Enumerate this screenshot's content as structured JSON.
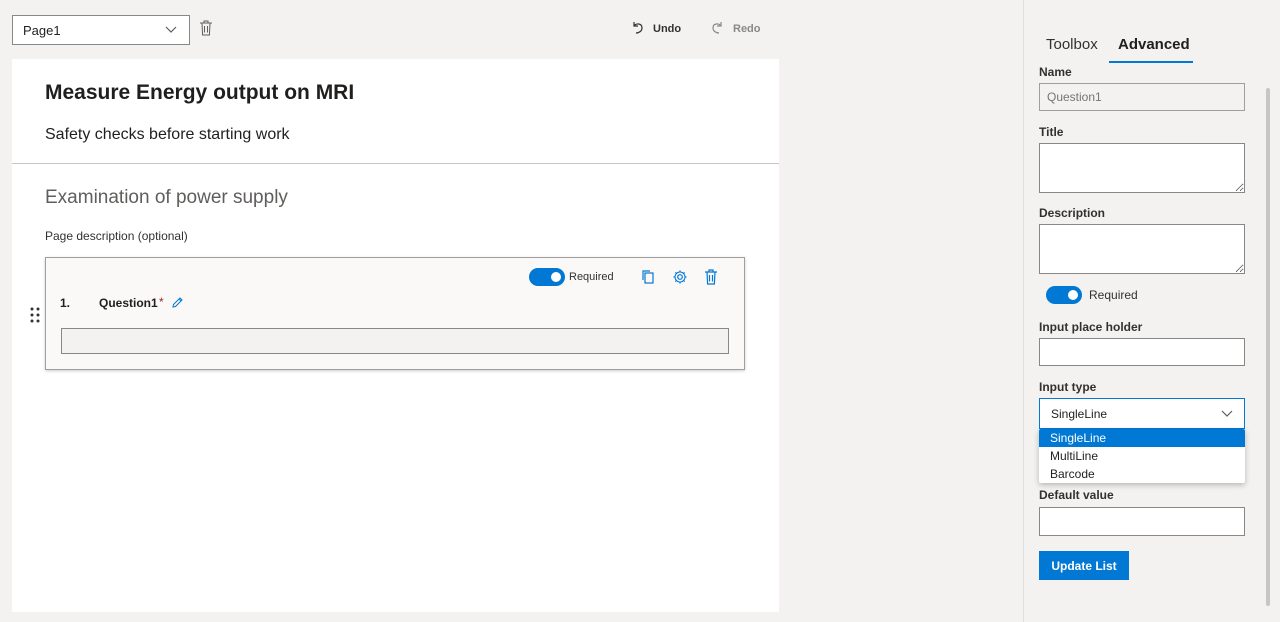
{
  "toolbar": {
    "page_selected": "Page1",
    "undo_label": "Undo",
    "redo_label": "Redo"
  },
  "form": {
    "title": "Measure Energy output on MRI",
    "description": "Safety checks before starting work",
    "page_title": "Examination of power supply",
    "page_description": "Page description (optional)"
  },
  "question": {
    "number": "1.",
    "name": "Question1",
    "required_marker": "*",
    "required_label": "Required",
    "required": true
  },
  "panel": {
    "tabs": [
      {
        "label": "Toolbox",
        "active": false
      },
      {
        "label": "Advanced",
        "active": true
      }
    ],
    "name_label": "Name",
    "name_placeholder": "Question1",
    "title_label": "Title",
    "description_label": "Description",
    "required_label": "Required",
    "placeholder_label": "Input place holder",
    "input_type_label": "Input type",
    "input_type_value": "SingleLine",
    "input_type_options": [
      "SingleLine",
      "MultiLine",
      "Barcode"
    ],
    "default_value_label": "Default value",
    "update_button": "Update List"
  },
  "colors": {
    "accent": "#0078d4",
    "required_star": "#a4262c"
  }
}
